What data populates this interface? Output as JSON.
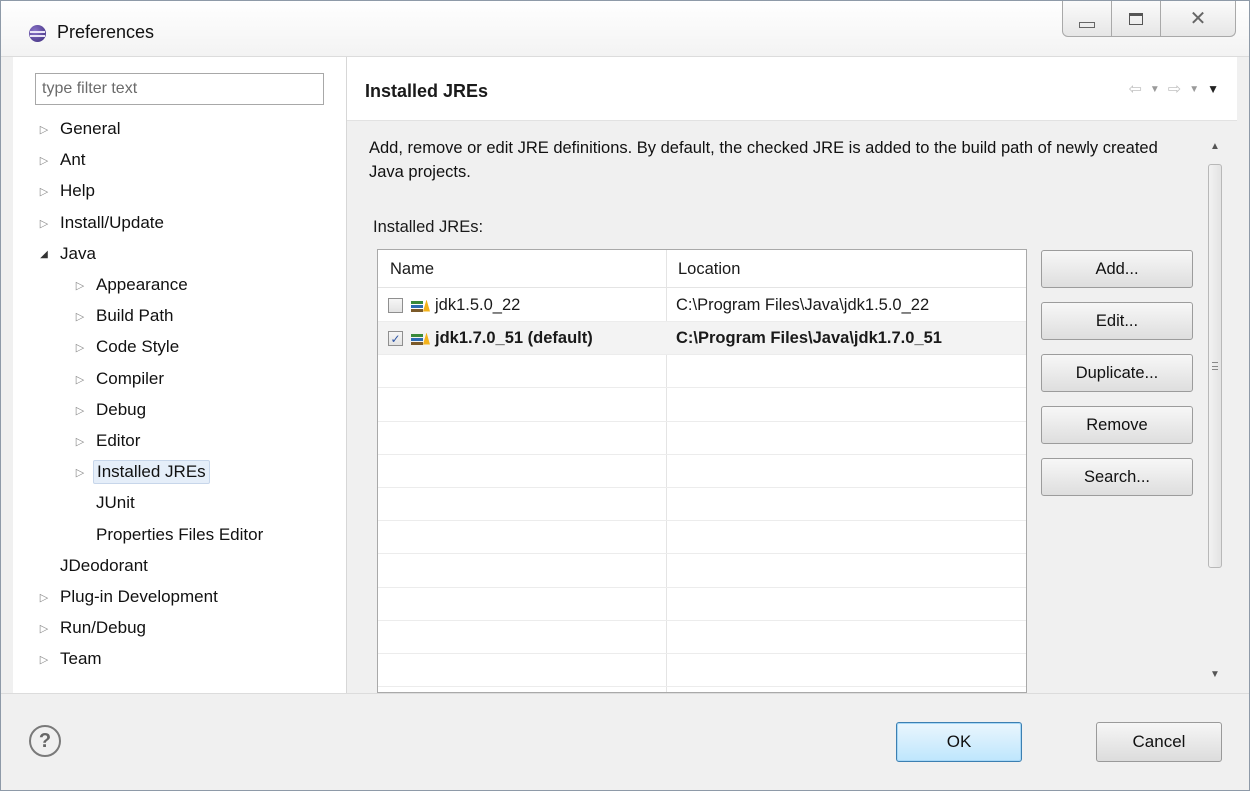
{
  "window": {
    "title": "Preferences"
  },
  "filter": {
    "placeholder": "type filter text",
    "value": ""
  },
  "tree": [
    {
      "label": "General",
      "level": 0,
      "twisty": "closed"
    },
    {
      "label": "Ant",
      "level": 0,
      "twisty": "closed"
    },
    {
      "label": "Help",
      "level": 0,
      "twisty": "closed"
    },
    {
      "label": "Install/Update",
      "level": 0,
      "twisty": "closed"
    },
    {
      "label": "Java",
      "level": 0,
      "twisty": "open"
    },
    {
      "label": "Appearance",
      "level": 1,
      "twisty": "closed"
    },
    {
      "label": "Build Path",
      "level": 1,
      "twisty": "closed"
    },
    {
      "label": "Code Style",
      "level": 1,
      "twisty": "closed"
    },
    {
      "label": "Compiler",
      "level": 1,
      "twisty": "closed"
    },
    {
      "label": "Debug",
      "level": 1,
      "twisty": "closed"
    },
    {
      "label": "Editor",
      "level": 1,
      "twisty": "closed"
    },
    {
      "label": "Installed JREs",
      "level": 1,
      "twisty": "closed",
      "selected": true
    },
    {
      "label": "JUnit",
      "level": 1,
      "twisty": "none"
    },
    {
      "label": "Properties Files Editor",
      "level": 1,
      "twisty": "none"
    },
    {
      "label": "JDeodorant",
      "level": 0,
      "twisty": "none"
    },
    {
      "label": "Plug-in Development",
      "level": 0,
      "twisty": "closed"
    },
    {
      "label": "Run/Debug",
      "level": 0,
      "twisty": "closed"
    },
    {
      "label": "Team",
      "level": 0,
      "twisty": "closed"
    }
  ],
  "page": {
    "title": "Installed JREs",
    "description": "Add, remove or edit JRE definitions. By default, the checked JRE is added to the build path of newly created Java projects.",
    "table_label": "Installed JREs:",
    "columns": {
      "name": "Name",
      "location": "Location"
    },
    "rows": [
      {
        "name": "jdk1.5.0_22",
        "location": "C:\\Program Files\\Java\\jdk1.5.0_22",
        "checked": false,
        "bold": false
      },
      {
        "name": "jdk1.7.0_51 (default)",
        "location": "C:\\Program Files\\Java\\jdk1.7.0_51",
        "checked": true,
        "bold": true
      }
    ],
    "buttons": {
      "add": "Add...",
      "edit": "Edit...",
      "duplicate": "Duplicate...",
      "remove": "Remove",
      "search": "Search..."
    }
  },
  "dialog_buttons": {
    "ok": "OK",
    "cancel": "Cancel"
  },
  "icons": {
    "help": "?",
    "close": "✕",
    "nav_back": "⇦",
    "nav_forward": "⇨",
    "dropdown": "▼",
    "twisty_closed": "▷",
    "twisty_open": "◢",
    "checkmark": "✓",
    "scroll_up": "▲",
    "scroll_down": "▼"
  },
  "colors": {
    "ok_button_border": "#3c7fb1",
    "selection": "#e5eef9"
  }
}
